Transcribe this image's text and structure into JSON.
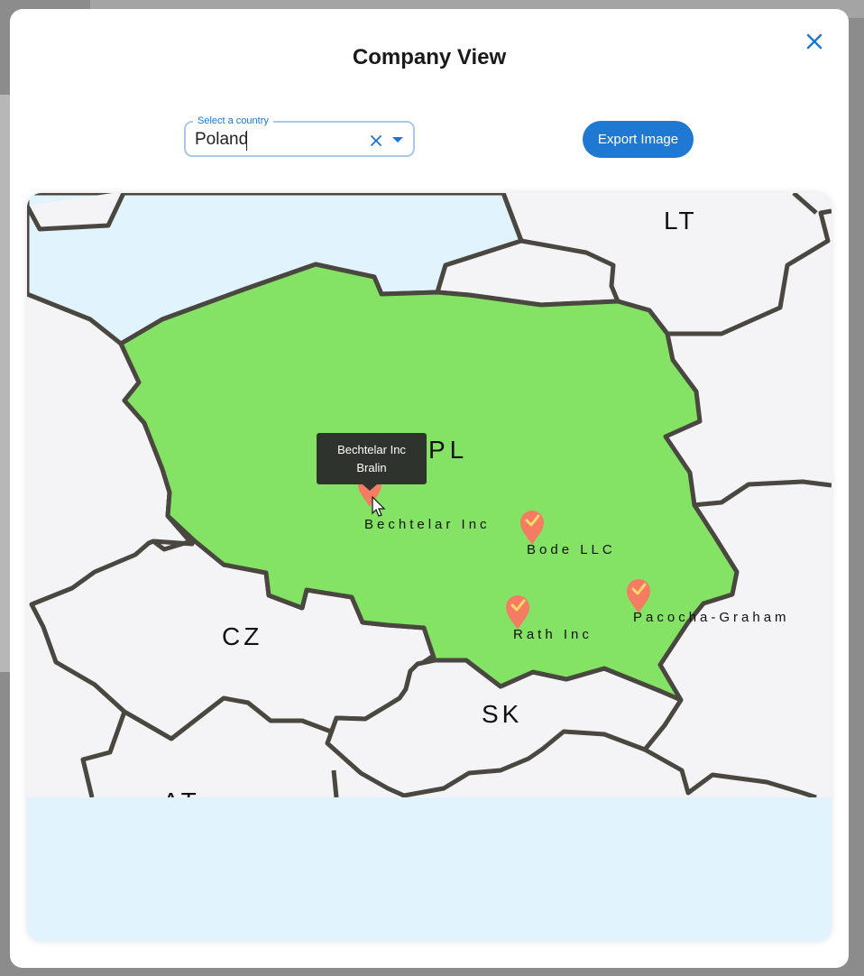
{
  "modal": {
    "title": "Company View",
    "close_icon": "close-icon"
  },
  "country_select": {
    "label": "Select a country",
    "value": "Poland",
    "clear_icon": "clear-icon",
    "dropdown_icon": "chevron-down-icon"
  },
  "export_button": {
    "label": "Export Image"
  },
  "map": {
    "highlight_color": "#84e264",
    "land_color": "#f4f4f7",
    "water_color": "#e1f3fc",
    "border_color": "#4a4740",
    "marker_color": "#f47c63",
    "country_labels": [
      "LT",
      "PL",
      "CZ",
      "SK",
      "AT"
    ],
    "markers": [
      {
        "name": "Bechtelar Inc",
        "city": "Bralin"
      },
      {
        "name": "Bode LLC"
      },
      {
        "name": "Rath Inc"
      },
      {
        "name": "Pacocha-Graham"
      }
    ],
    "tooltip": {
      "company": "Bechtelar Inc",
      "city": "Bralin"
    }
  }
}
